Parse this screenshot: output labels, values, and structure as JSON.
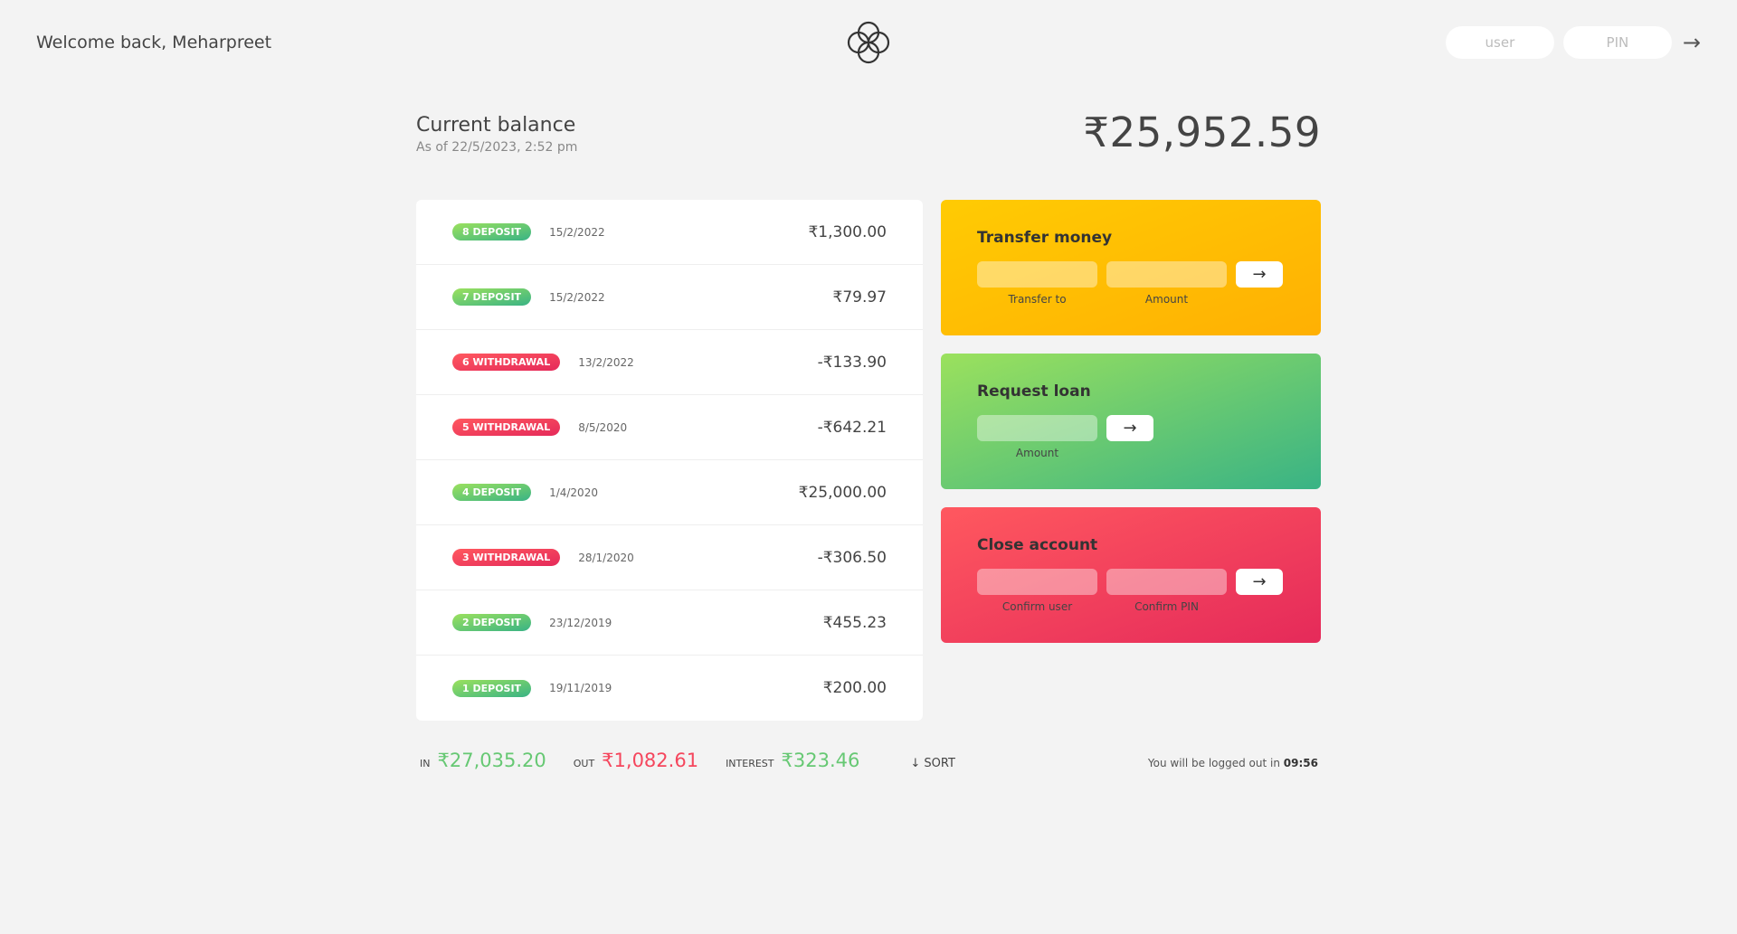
{
  "nav": {
    "welcome": "Welcome back, Meharpreet",
    "login_user_placeholder": "user",
    "login_pin_placeholder": "PIN",
    "login_button": "→"
  },
  "balance": {
    "label": "Current balance",
    "date_prefix": "As of",
    "date": "22/5/2023, 2:52 pm",
    "value": "₹25,952.59"
  },
  "movements": [
    {
      "index": "8",
      "type": "deposit",
      "label": "8 DEPOSIT",
      "date": "15/2/2022",
      "value": "₹1,300.00"
    },
    {
      "index": "7",
      "type": "deposit",
      "label": "7 DEPOSIT",
      "date": "15/2/2022",
      "value": "₹79.97"
    },
    {
      "index": "6",
      "type": "withdrawal",
      "label": "6 WITHDRAWAL",
      "date": "13/2/2022",
      "value": "-₹133.90"
    },
    {
      "index": "5",
      "type": "withdrawal",
      "label": "5 WITHDRAWAL",
      "date": "8/5/2020",
      "value": "-₹642.21"
    },
    {
      "index": "4",
      "type": "deposit",
      "label": "4 DEPOSIT",
      "date": "1/4/2020",
      "value": "₹25,000.00"
    },
    {
      "index": "3",
      "type": "withdrawal",
      "label": "3 WITHDRAWAL",
      "date": "28/1/2020",
      "value": "-₹306.50"
    },
    {
      "index": "2",
      "type": "deposit",
      "label": "2 DEPOSIT",
      "date": "23/12/2019",
      "value": "₹455.23"
    },
    {
      "index": "1",
      "type": "deposit",
      "label": "1 DEPOSIT",
      "date": "19/11/2019",
      "value": "₹200.00"
    }
  ],
  "operations": {
    "transfer": {
      "title": "Transfer money",
      "label_to": "Transfer to",
      "label_amount": "Amount",
      "button": "→"
    },
    "loan": {
      "title": "Request loan",
      "label_amount": "Amount",
      "button": "→"
    },
    "close": {
      "title": "Close account",
      "label_user": "Confirm user",
      "label_pin": "Confirm PIN",
      "button": "→"
    }
  },
  "summary": {
    "in_label": "In",
    "in_value": "₹27,035.20",
    "out_label": "Out",
    "out_value": "₹1,082.61",
    "interest_label": "Interest",
    "interest_value": "₹323.46",
    "sort_label": "↓ SORT"
  },
  "logout": {
    "text": "You will be logged out in",
    "timer": "09:56"
  },
  "colors": {
    "background": "#f3f3f3",
    "deposit": "#66c873",
    "withdrawal": "#f5465d",
    "transfer_card": "#ffb003",
    "loan_card": "#39b385",
    "close_card": "#e52a5a"
  }
}
